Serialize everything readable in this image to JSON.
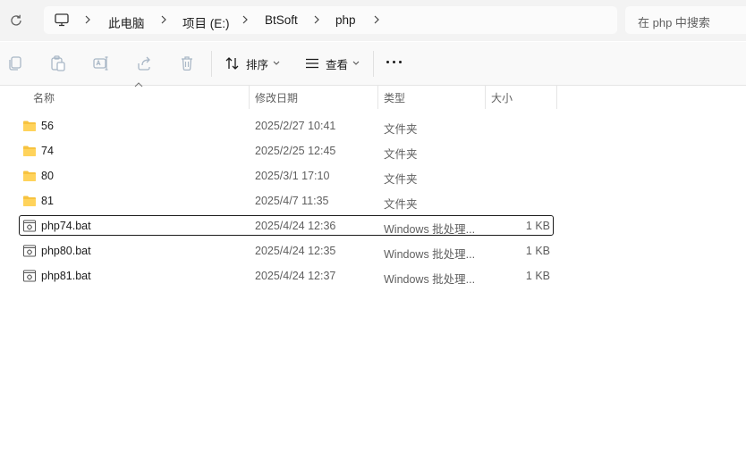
{
  "breadcrumb": {
    "items": [
      {
        "label": "此电脑"
      },
      {
        "label": "项目 (E:)"
      },
      {
        "label": "BtSoft"
      },
      {
        "label": "php"
      }
    ]
  },
  "search": {
    "placeholder": "在 php 中搜索"
  },
  "toolbar": {
    "sort_label": "排序",
    "view_label": "查看"
  },
  "columns": {
    "name": "名称",
    "date": "修改日期",
    "type": "类型",
    "size": "大小"
  },
  "files": [
    {
      "name": "56",
      "date": "2025/2/27 10:41",
      "type": "文件夹",
      "size": "",
      "kind": "folder"
    },
    {
      "name": "74",
      "date": "2025/2/25 12:45",
      "type": "文件夹",
      "size": "",
      "kind": "folder"
    },
    {
      "name": "80",
      "date": "2025/3/1 17:10",
      "type": "文件夹",
      "size": "",
      "kind": "folder"
    },
    {
      "name": "81",
      "date": "2025/4/7 11:35",
      "type": "文件夹",
      "size": "",
      "kind": "folder"
    },
    {
      "name": "php74.bat",
      "date": "2025/4/24 12:36",
      "type": "Windows 批处理...",
      "size": "1 KB",
      "kind": "bat",
      "selected": true
    },
    {
      "name": "php80.bat",
      "date": "2025/4/24 12:35",
      "type": "Windows 批处理...",
      "size": "1 KB",
      "kind": "bat"
    },
    {
      "name": "php81.bat",
      "date": "2025/4/24 12:37",
      "type": "Windows 批处理...",
      "size": "1 KB",
      "kind": "bat"
    }
  ],
  "colors": {
    "folder": "#f7c33f",
    "selection_border": "#1b1b1b",
    "icon_disabled": "#a9b7c6"
  }
}
